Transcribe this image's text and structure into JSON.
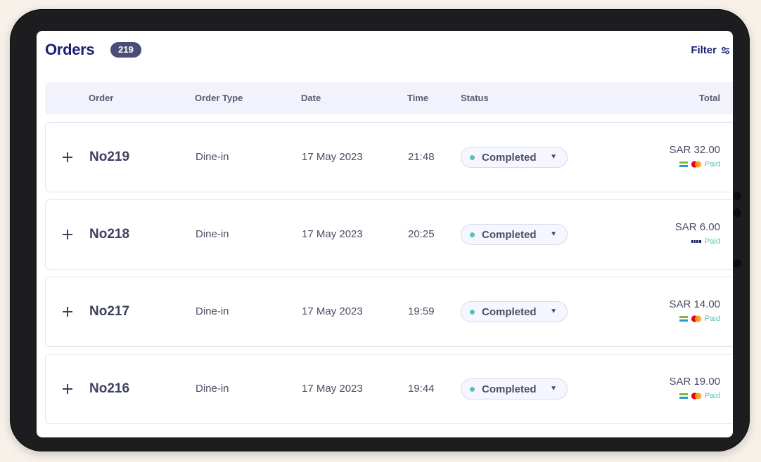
{
  "header": {
    "title": "Orders",
    "count": "219",
    "filter_label": "Filter"
  },
  "columns": {
    "order": "Order",
    "type": "Order Type",
    "date": "Date",
    "time": "Time",
    "status": "Status",
    "total": "Total"
  },
  "orders": [
    {
      "number": "No219",
      "type": "Dine-in",
      "date": "17 May 2023",
      "time": "21:48",
      "status": "Completed",
      "total": "SAR 32.00",
      "payment": "Paid",
      "method_icon": "mada-mastercard-icon"
    },
    {
      "number": "No218",
      "type": "Dine-in",
      "date": "17 May 2023",
      "time": "20:25",
      "status": "Completed",
      "total": "SAR 6.00",
      "payment": "Paid",
      "method_icon": "visa-icon"
    },
    {
      "number": "No217",
      "type": "Dine-in",
      "date": "17 May 2023",
      "time": "19:59",
      "status": "Completed",
      "total": "SAR 14.00",
      "payment": "Paid",
      "method_icon": "mada-mastercard-icon"
    },
    {
      "number": "No216",
      "type": "Dine-in",
      "date": "17 May 2023",
      "time": "19:44",
      "status": "Completed",
      "total": "SAR 19.00",
      "payment": "Paid",
      "method_icon": "mada-mastercard-icon"
    }
  ],
  "colors": {
    "brand": "#1b1f72",
    "badge": "#4b4d78",
    "header_bg": "#f1f2fb",
    "paid": "#5ac0b3",
    "status_dot": "#5ac0b3"
  }
}
